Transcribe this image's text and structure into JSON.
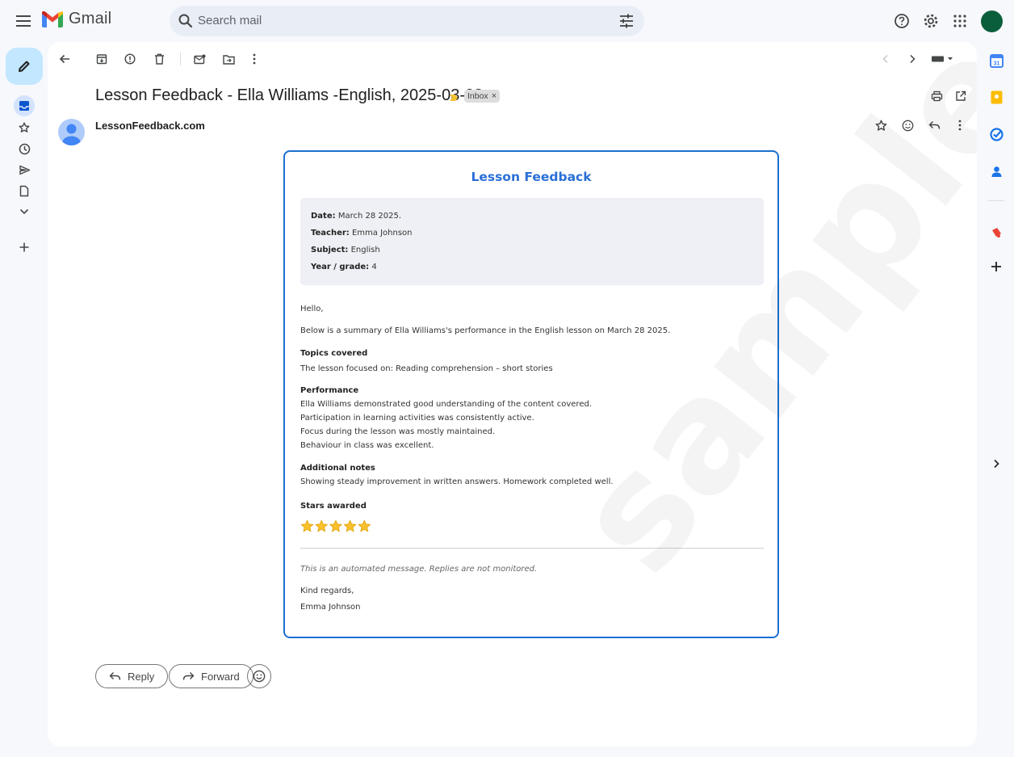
{
  "app": {
    "name": "Gmail"
  },
  "search": {
    "placeholder": "Search mail"
  },
  "email": {
    "subject": "Lesson Feedback - Ella Williams -English, 2025-03-28",
    "label": "Inbox",
    "sender": "LessonFeedback.com",
    "body": {
      "title": "Lesson Feedback",
      "info": [
        {
          "label": "Date:",
          "value": "March 28 2025."
        },
        {
          "label": "Teacher:",
          "value": "Emma Johnson"
        },
        {
          "label": "Subject:",
          "value": "English"
        },
        {
          "label": "Year / grade:",
          "value": "4"
        }
      ],
      "greeting": "Hello,",
      "intro": "Below is a summary of Ella Williams's performance in the English lesson on March 28 2025.",
      "topics_heading": "Topics covered",
      "topics_text": "The lesson focused on: Reading comprehension – short stories",
      "performance_heading": "Performance",
      "performance_lines": [
        "Ella Williams demonstrated good understanding of the content covered.",
        "Participation in learning activities was consistently active.",
        "Focus during the lesson was mostly maintained.",
        "Behaviour in class was excellent."
      ],
      "notes_heading": "Additional notes",
      "notes_text": "Showing steady improvement in written answers. Homework completed well.",
      "stars_heading": "Stars awarded",
      "stars": "⭐⭐⭐⭐⭐",
      "stars_count": 5,
      "automated_note": "This is an automated message. Replies are not monitored.",
      "closing": "Kind regards,",
      "signature": "Emma Johnson"
    }
  },
  "actions": {
    "reply": "Reply",
    "forward": "Forward"
  },
  "watermark": "sample",
  "colors": {
    "accent": "#2a6fd6",
    "compose_bg": "#c2e7ff",
    "border": "#1a6fd1"
  }
}
